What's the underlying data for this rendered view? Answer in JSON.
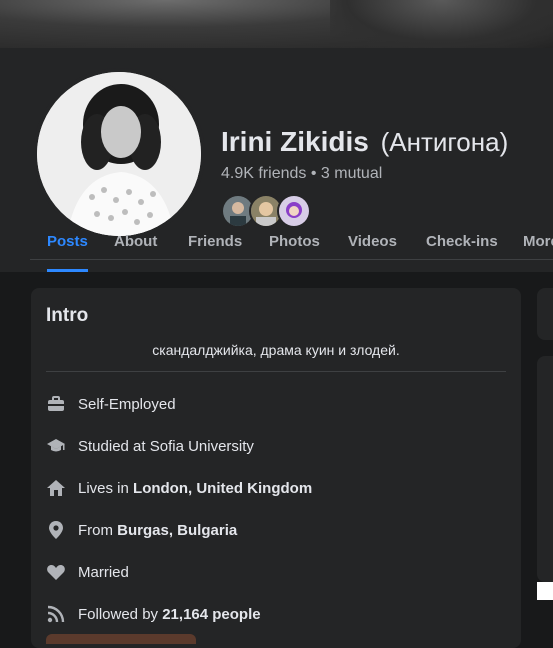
{
  "profile": {
    "name": "Irini Zikidis",
    "alt_name": "(Антигона)",
    "friends_count": "4.9K friends",
    "separator": "•",
    "mutual": "3 mutual"
  },
  "tabs": [
    {
      "label": "Posts",
      "active": true
    },
    {
      "label": "About",
      "active": false
    },
    {
      "label": "Friends",
      "active": false
    },
    {
      "label": "Photos",
      "active": false
    },
    {
      "label": "Videos",
      "active": false
    },
    {
      "label": "Check-ins",
      "active": false
    },
    {
      "label": "More",
      "active": false
    }
  ],
  "intro": {
    "title": "Intro",
    "bio": "скандалджийка, драма куин и злодей.",
    "items": [
      {
        "icon": "briefcase-icon",
        "prefix": "Self-Employed",
        "bold": ""
      },
      {
        "icon": "graduation-cap-icon",
        "prefix": "Studied at Sofia University",
        "bold": ""
      },
      {
        "icon": "home-icon",
        "prefix": "Lives in ",
        "bold": "London, United Kingdom"
      },
      {
        "icon": "location-pin-icon",
        "prefix": "From ",
        "bold": "Burgas, Bulgaria"
      },
      {
        "icon": "heart-icon",
        "prefix": "Married",
        "bold": ""
      },
      {
        "icon": "rss-icon",
        "prefix": "Followed by ",
        "bold": "21,164 people"
      }
    ]
  },
  "colors": {
    "background": "#18191a",
    "card": "#242526",
    "accent": "#2d88ff",
    "text_primary": "#e4e6eb",
    "text_secondary": "#b0b3b8"
  }
}
